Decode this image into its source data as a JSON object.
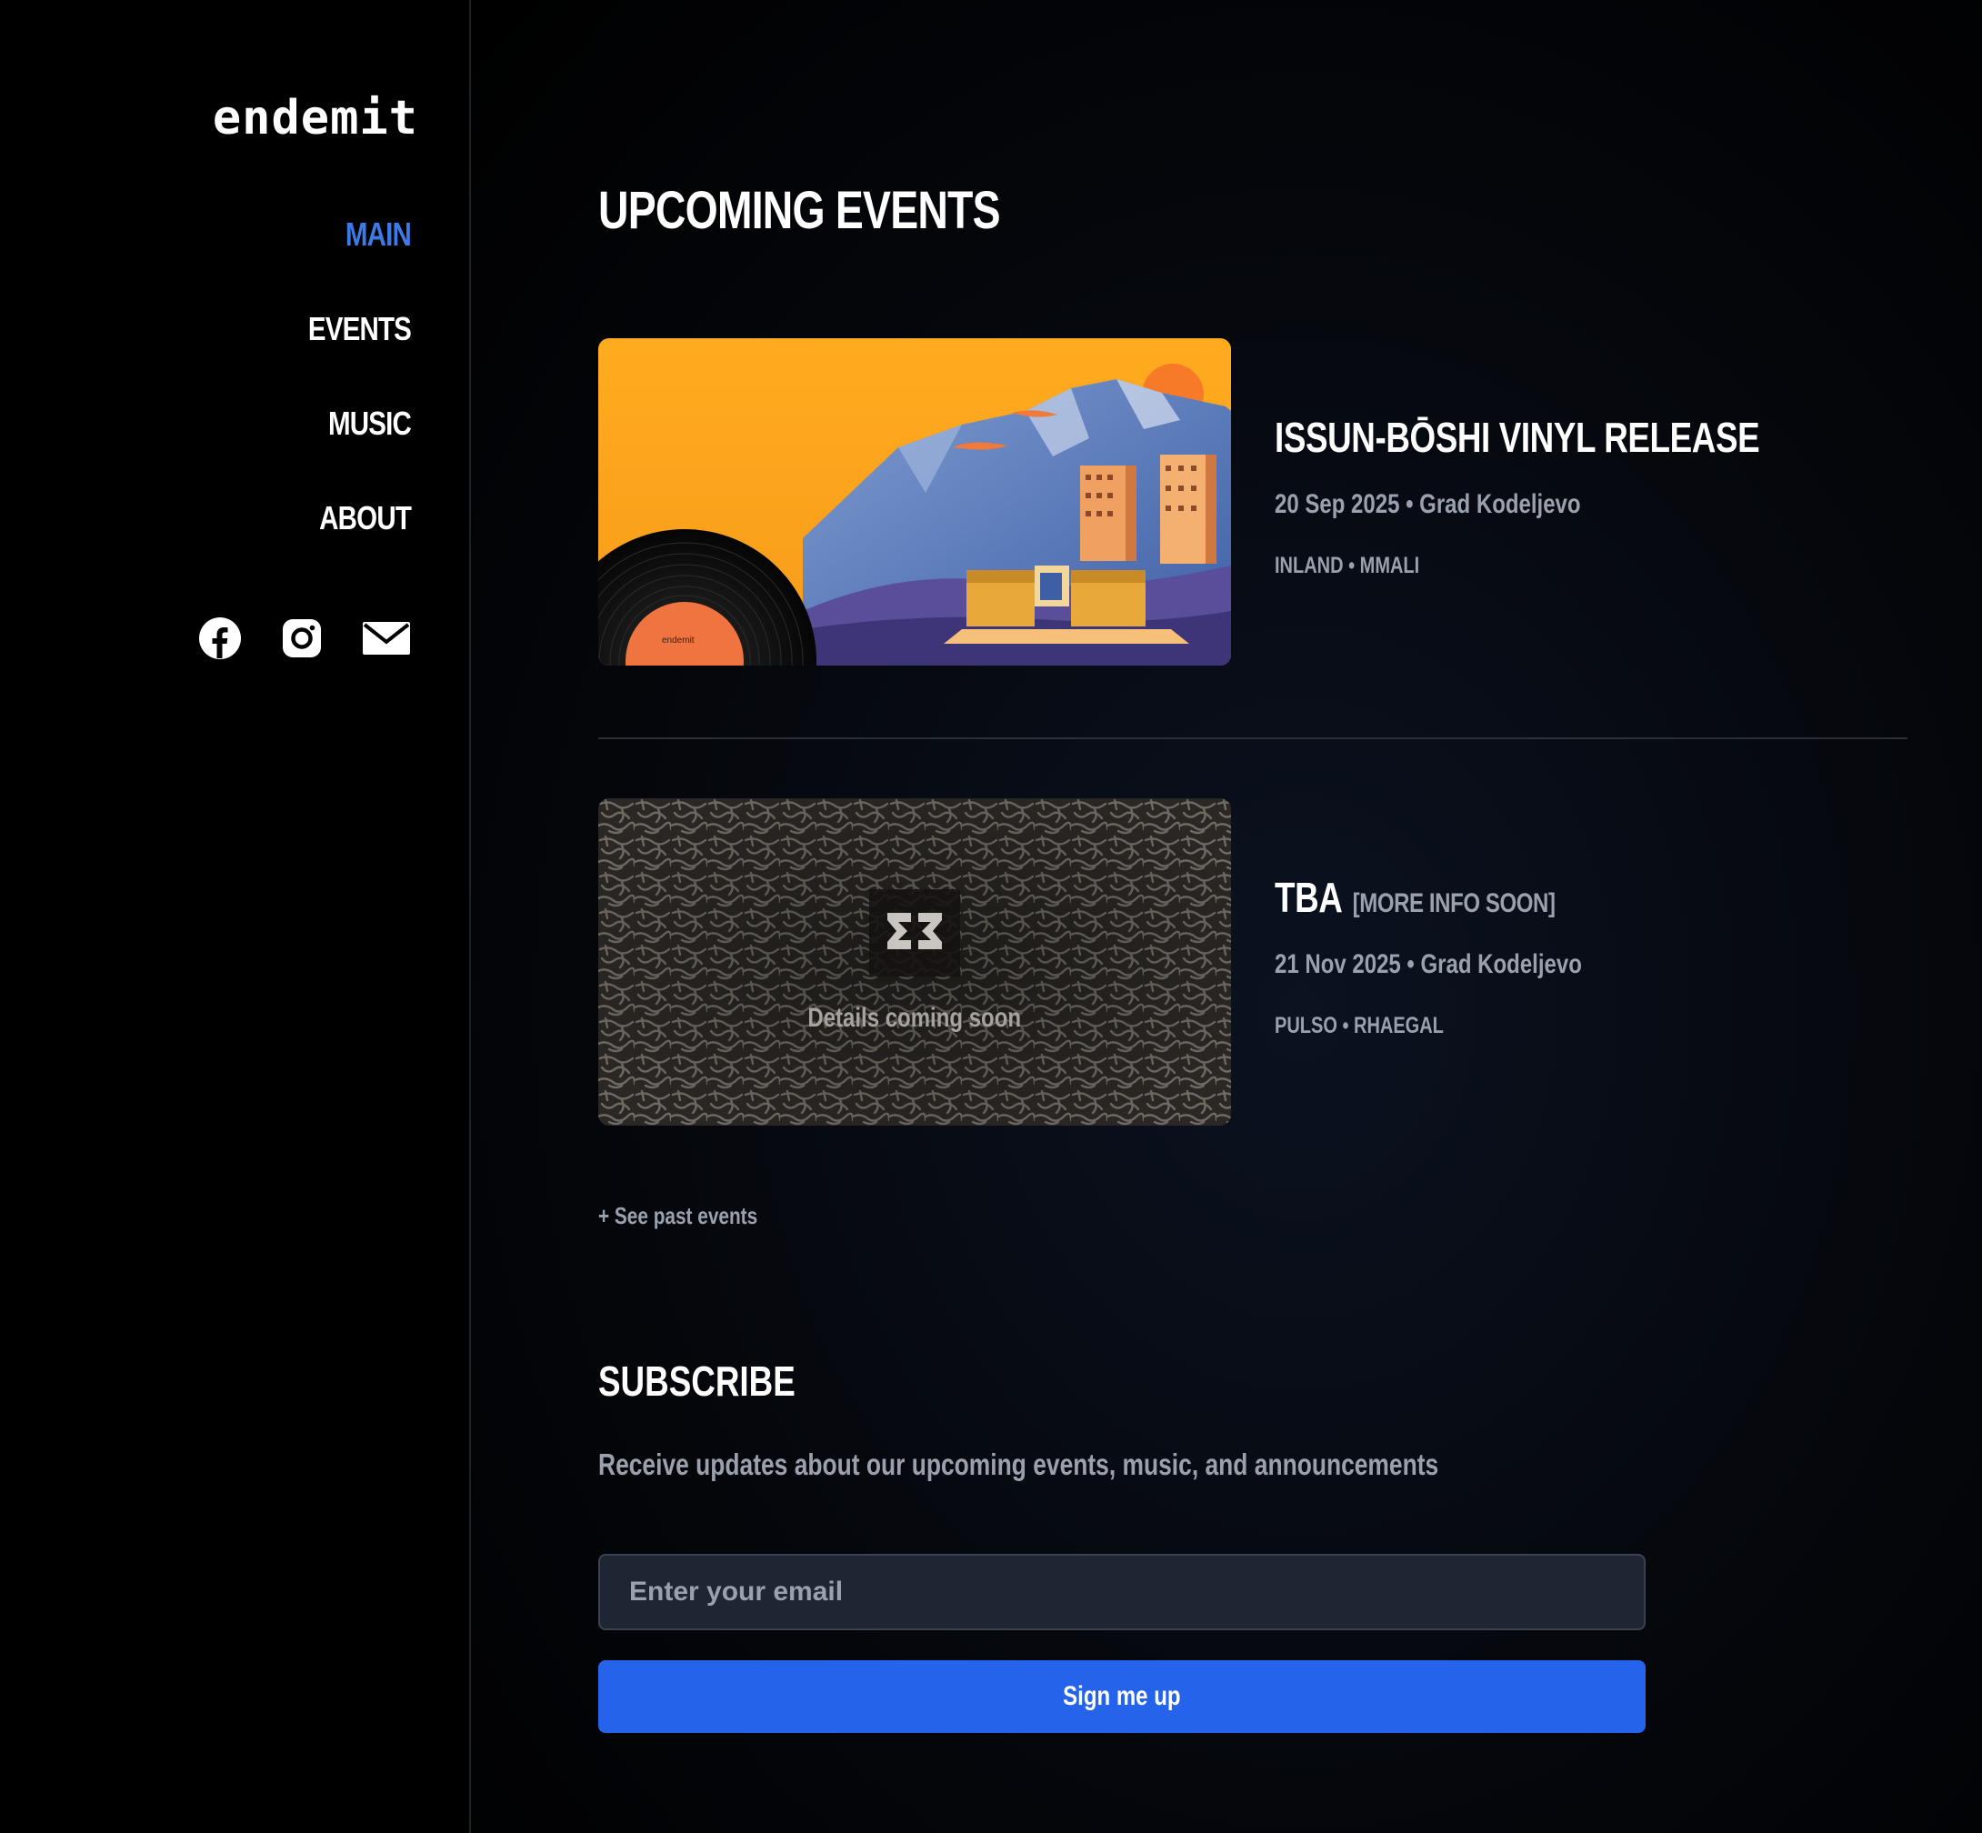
{
  "brand": {
    "logo": "endemit"
  },
  "nav": {
    "items": [
      {
        "label": "MAIN",
        "active": true
      },
      {
        "label": "EVENTS",
        "active": false
      },
      {
        "label": "MUSIC",
        "active": false
      },
      {
        "label": "ABOUT",
        "active": false
      }
    ]
  },
  "socials": [
    "facebook-icon",
    "instagram-icon",
    "mail-icon"
  ],
  "upcoming": {
    "title": "UPCOMING EVENTS",
    "events": [
      {
        "title": "ISSUN-BŌSHI VINYL RELEASE",
        "tag": "",
        "meta": "20 Sep 2025 • Grad Kodeljevo",
        "artists": "INLAND • MMALI",
        "record_label": "endemit"
      },
      {
        "title": "TBA",
        "tag": "[MORE INFO SOON]",
        "meta": "21 Nov 2025 • Grad Kodeljevo",
        "artists": "PULSO • RHAEGAL",
        "placeholder": "Details coming soon"
      }
    ],
    "past_link": "+ See past events"
  },
  "subscribe": {
    "title": "SUBSCRIBE",
    "description": "Receive updates about our upcoming events, music, and announcements",
    "email_placeholder": "Enter your email",
    "button_label": "Sign me up"
  },
  "colors": {
    "accent": "#3b7be8",
    "button": "#2563eb",
    "muted": "#9aa1ad"
  }
}
